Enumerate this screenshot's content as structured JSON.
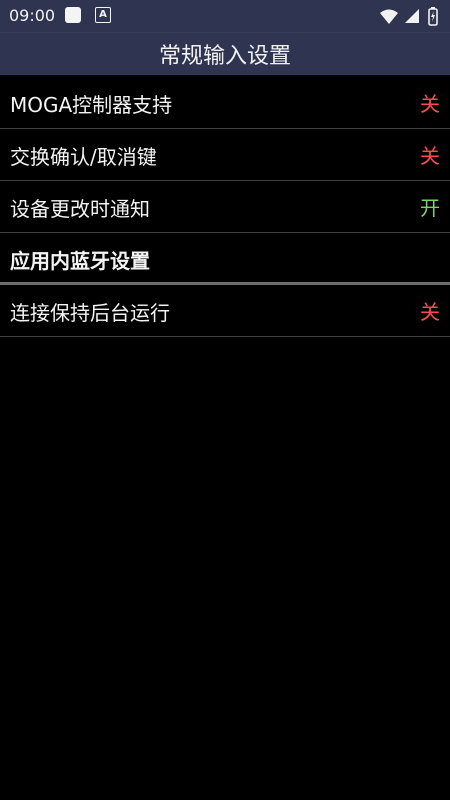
{
  "status_bar": {
    "time": "09:00",
    "app_icon": "square-app-icon",
    "a_icon": "A",
    "wifi_icon": "wifi-icon",
    "signal_icon": "cell-signal-icon",
    "battery_icon": "battery-charging-icon"
  },
  "header": {
    "title": "常规输入设置"
  },
  "settings": [
    {
      "label": "MOGA控制器支持",
      "value": "关",
      "value_color": "#ff4b4b"
    },
    {
      "label": "交换确认/取消键",
      "value": "关",
      "value_color": "#ff4b4b"
    },
    {
      "label": "设备更改时通知",
      "value": "开",
      "value_color": "#7bd26b"
    },
    {
      "label": "应用内蓝牙设置",
      "value": "",
      "value_color": ""
    },
    {
      "label": "连接保持后台运行",
      "value": "关",
      "value_color": "#ff4b4b"
    }
  ],
  "colors": {
    "bar_background": "#2f3450",
    "page_background": "#000000",
    "off": "#ff4b4b",
    "on": "#7bd26b"
  }
}
